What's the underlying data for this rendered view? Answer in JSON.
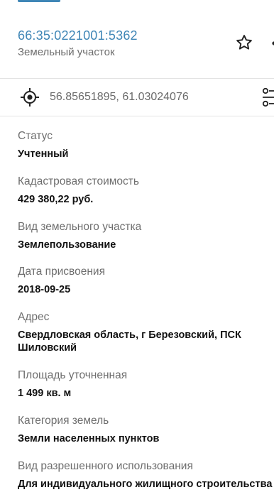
{
  "header": {
    "cadastral_number": "66:35:0221001:5362",
    "object_type": "Земельный участок"
  },
  "coordinates": {
    "text": "56.85651895, 61.03024076"
  },
  "icons": {
    "favorite": "star-icon",
    "share": "share-icon",
    "locate": "crosshair-target-icon",
    "route": "route-icon"
  },
  "colors": {
    "accent": "#3f86b6",
    "label": "#6e6e6e",
    "value": "#111111",
    "divider": "#e3e3e3"
  },
  "fields": [
    {
      "label": "Статус",
      "value": "Учтенный"
    },
    {
      "label": "Кадастровая стоимость",
      "value": "429 380,22 руб."
    },
    {
      "label": "Вид земельного участка",
      "value": "Землепользование"
    },
    {
      "label": "Дата присвоения",
      "value": "2018-09-25"
    },
    {
      "label": "Адрес",
      "value": "Свердловская область, г Березовский, ПСК Шиловский"
    },
    {
      "label": "Площадь уточненная",
      "value": "1 499 кв. м"
    },
    {
      "label": "Категория земель",
      "value": "Земли населенных пунктов"
    },
    {
      "label": "Вид разрешенного использования",
      "value": "Для индивидуального жилищного строительства"
    }
  ]
}
